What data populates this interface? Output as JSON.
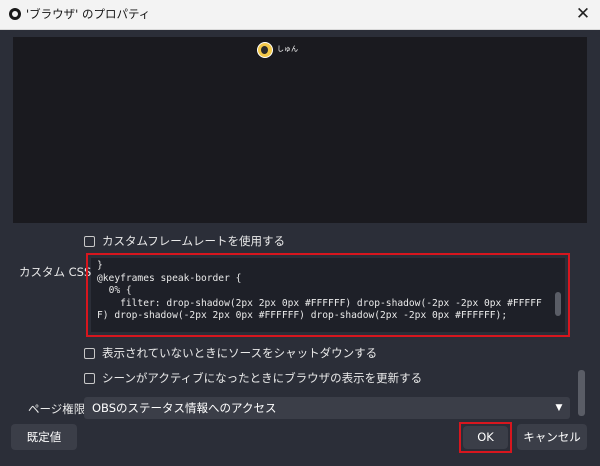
{
  "window": {
    "title": "'ブラウザ' のプロパティ",
    "close_glyph": "✕"
  },
  "preview": {
    "user_name": "しゅん"
  },
  "options": {
    "custom_fps_label": "カスタムフレームレートを使用する",
    "shutdown_label": "表示されていないときにソースをシャットダウンする",
    "refresh_label": "シーンがアクティブになったときにブラウザの表示を更新する"
  },
  "custom_css": {
    "label": "カスタム CSS",
    "value": "}\n@keyframes speak-border {\n  0% {\n    filter: drop-shadow(2px 2px 0px #FFFFFF) drop-shadow(-2px -2px 0px #FFFFFF) drop-shadow(-2px 2px 0px #FFFFFF) drop-shadow(2px -2px 0px #FFFFFF);"
  },
  "page_permissions": {
    "label": "ページ権限",
    "selected": "OBSのステータス情報へのアクセス",
    "arrow_glyph": "▼"
  },
  "buttons": {
    "defaults": "既定値",
    "ok": "OK",
    "cancel": "キャンセル"
  },
  "colors": {
    "highlight": "#d7161e",
    "background": "#2b2e38",
    "control": "#3b3e48"
  }
}
